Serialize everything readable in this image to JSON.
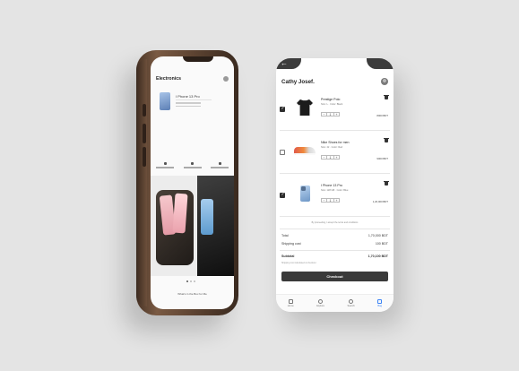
{
  "left_phone": {
    "category_title": "Electronics",
    "product_name": "I Phone 13 Pro",
    "box_title": "What's in the Box for Me"
  },
  "right_phone": {
    "user_name": "Cathy Josef.",
    "back_icon": "arrow-left-icon",
    "items": [
      {
        "name": "Prestige Polo",
        "meta": "Size: L · Color: Black",
        "qty": "1",
        "price": "8000 BDT",
        "checked": true,
        "icon": "shirt-icon"
      },
      {
        "name": "Nike Shoes for men",
        "meta": "Size: 42 · Color: Red",
        "qty": "1",
        "price": "9000 BDT",
        "checked": false,
        "icon": "shoe-icon"
      },
      {
        "name": "I Phone 13 Pro",
        "meta": "Size: 128 GB · Color: Blue",
        "qty": "1",
        "price": "1,20,000 BDT",
        "checked": true,
        "icon": "phone-icon"
      }
    ],
    "terms_text": "By proceeding, I accept the terms and conditions",
    "summary": {
      "total_label": "Total",
      "total_value": "1,70,000 BDT",
      "shipping_label": "Shipping cost",
      "shipping_value": "100 BDT",
      "subtotal_label": "Subtotal",
      "subtotal_value": "1,70,100 BDT",
      "note": "Shipping cost calculated at checkout"
    },
    "checkout_label": "Checkout",
    "tabs": [
      {
        "label": "Home",
        "icon": "home-icon",
        "active": false
      },
      {
        "label": "Explore",
        "icon": "explore-icon",
        "active": false
      },
      {
        "label": "Search",
        "icon": "search-icon",
        "active": false
      },
      {
        "label": "Bag",
        "icon": "bag-icon",
        "active": true
      }
    ],
    "accent_color": "#3b82f6"
  }
}
